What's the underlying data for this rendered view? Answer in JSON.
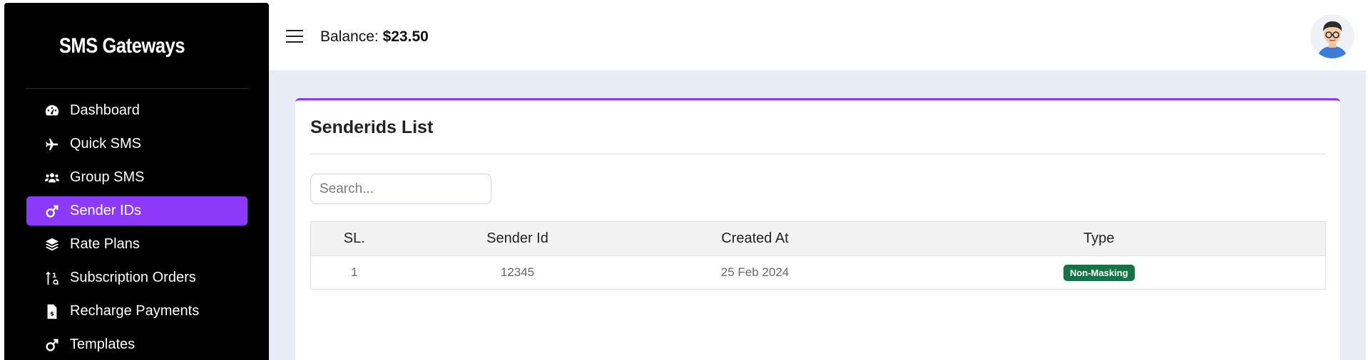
{
  "sidebar": {
    "brand": "SMS Gateways",
    "items": [
      {
        "label": "Dashboard",
        "icon": "gauge-icon"
      },
      {
        "label": "Quick SMS",
        "icon": "plane-icon"
      },
      {
        "label": "Group SMS",
        "icon": "users-icon"
      },
      {
        "label": "Sender IDs",
        "icon": "mars-icon",
        "active": true
      },
      {
        "label": "Rate Plans",
        "icon": "layers-icon"
      },
      {
        "label": "Subscription Orders",
        "icon": "sort-icon"
      },
      {
        "label": "Recharge Payments",
        "icon": "invoice-icon"
      },
      {
        "label": "Templates",
        "icon": "mars-icon"
      }
    ]
  },
  "header": {
    "balance_label": "Balance:",
    "balance_value": "$23.50"
  },
  "page": {
    "title": "Senderids List",
    "search_placeholder": "Search...",
    "columns": [
      "SL.",
      "Sender Id",
      "Created At",
      "Type"
    ],
    "rows": [
      {
        "sl": "1",
        "sender_id": "12345",
        "created_at": "25 Feb 2024",
        "type": "Non-Masking"
      }
    ]
  },
  "colors": {
    "accent": "#8c39fa",
    "badge": "#157347",
    "sidebar_bg": "#000000",
    "content_bg": "#e8ecf5"
  }
}
